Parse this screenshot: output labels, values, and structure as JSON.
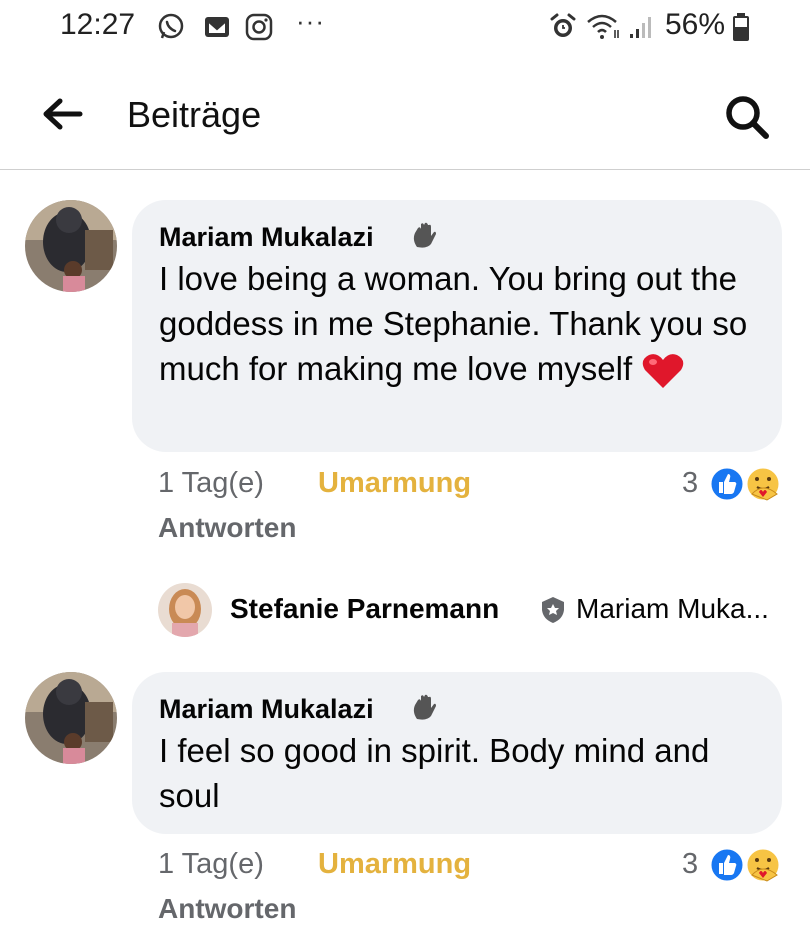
{
  "status_bar": {
    "time": "12:27",
    "notification_icons": [
      "whatsapp-icon",
      "gmail-icon",
      "instagram-icon"
    ],
    "overflow": "···",
    "battery": "56%",
    "system_icons": [
      "alarm-icon",
      "wifi-icon",
      "signal-icon",
      "battery-icon"
    ]
  },
  "header": {
    "title": "Beiträge",
    "back_icon": "back-arrow-icon",
    "search_icon": "search-icon"
  },
  "comments": [
    {
      "author": "Mariam Mukalazi",
      "badge_icon": "waving-hand-icon",
      "text": "I love being a woman. You bring out the goddess in me Stephanie. Thank you so much for making me love myself",
      "emoji": "❤️",
      "time": "1 Tag(e)",
      "reaction_label": "Umarmung",
      "reply_label": "Antworten",
      "reaction_count": "3",
      "reaction_icons": [
        "like-icon",
        "care-icon"
      ]
    },
    {
      "author": "Mariam Mukalazi",
      "badge_icon": "waving-hand-icon",
      "text": "I feel so good in spirit. Body mind and soul",
      "time": "1 Tag(e)",
      "reaction_label": "Umarmung",
      "reply_label": "Antworten",
      "reaction_count": "3",
      "reaction_icons": [
        "like-icon",
        "care-icon"
      ]
    }
  ],
  "reply_preview": {
    "author": "Stefanie Parnemann",
    "badge_icon": "author-shield-icon",
    "snippet": "Mariam Muka..."
  },
  "colors": {
    "bubble": "#f0f2f5",
    "reaction_active": "#e4b23e",
    "meta_text": "#65676b",
    "like_blue": "#1877f2"
  }
}
